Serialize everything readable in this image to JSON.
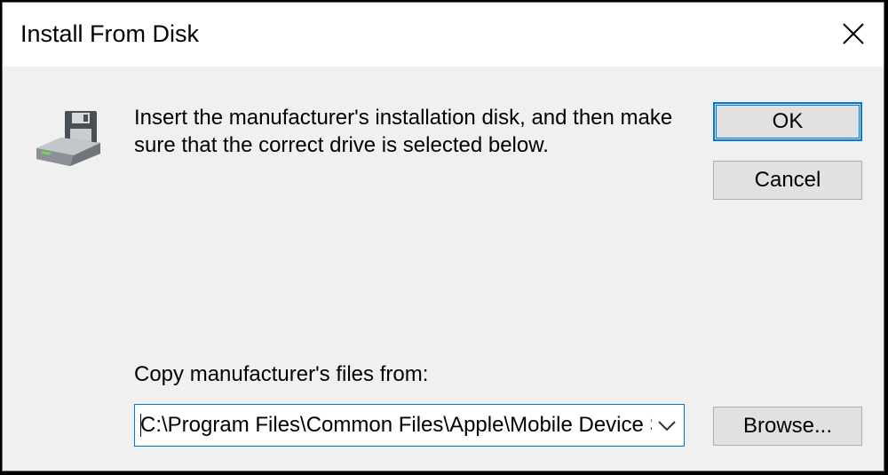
{
  "window": {
    "title": "Install From Disk"
  },
  "message": "Insert the manufacturer's installation disk, and then make sure that the correct drive is selected below.",
  "buttons": {
    "ok": "OK",
    "cancel": "Cancel",
    "browse": "Browse..."
  },
  "copy_from": {
    "label": "Copy manufacturer's files from:",
    "value": "C:\\Program Files\\Common Files\\Apple\\Mobile Device Support\\Drivers"
  },
  "icons": {
    "close": "close-icon",
    "disk": "floppy-disk-drive-icon",
    "dropdown": "chevron-down-icon"
  },
  "colors": {
    "accent": "#0078d7",
    "dialog_background": "#f0f0f0",
    "button_face": "#e1e1e1"
  }
}
